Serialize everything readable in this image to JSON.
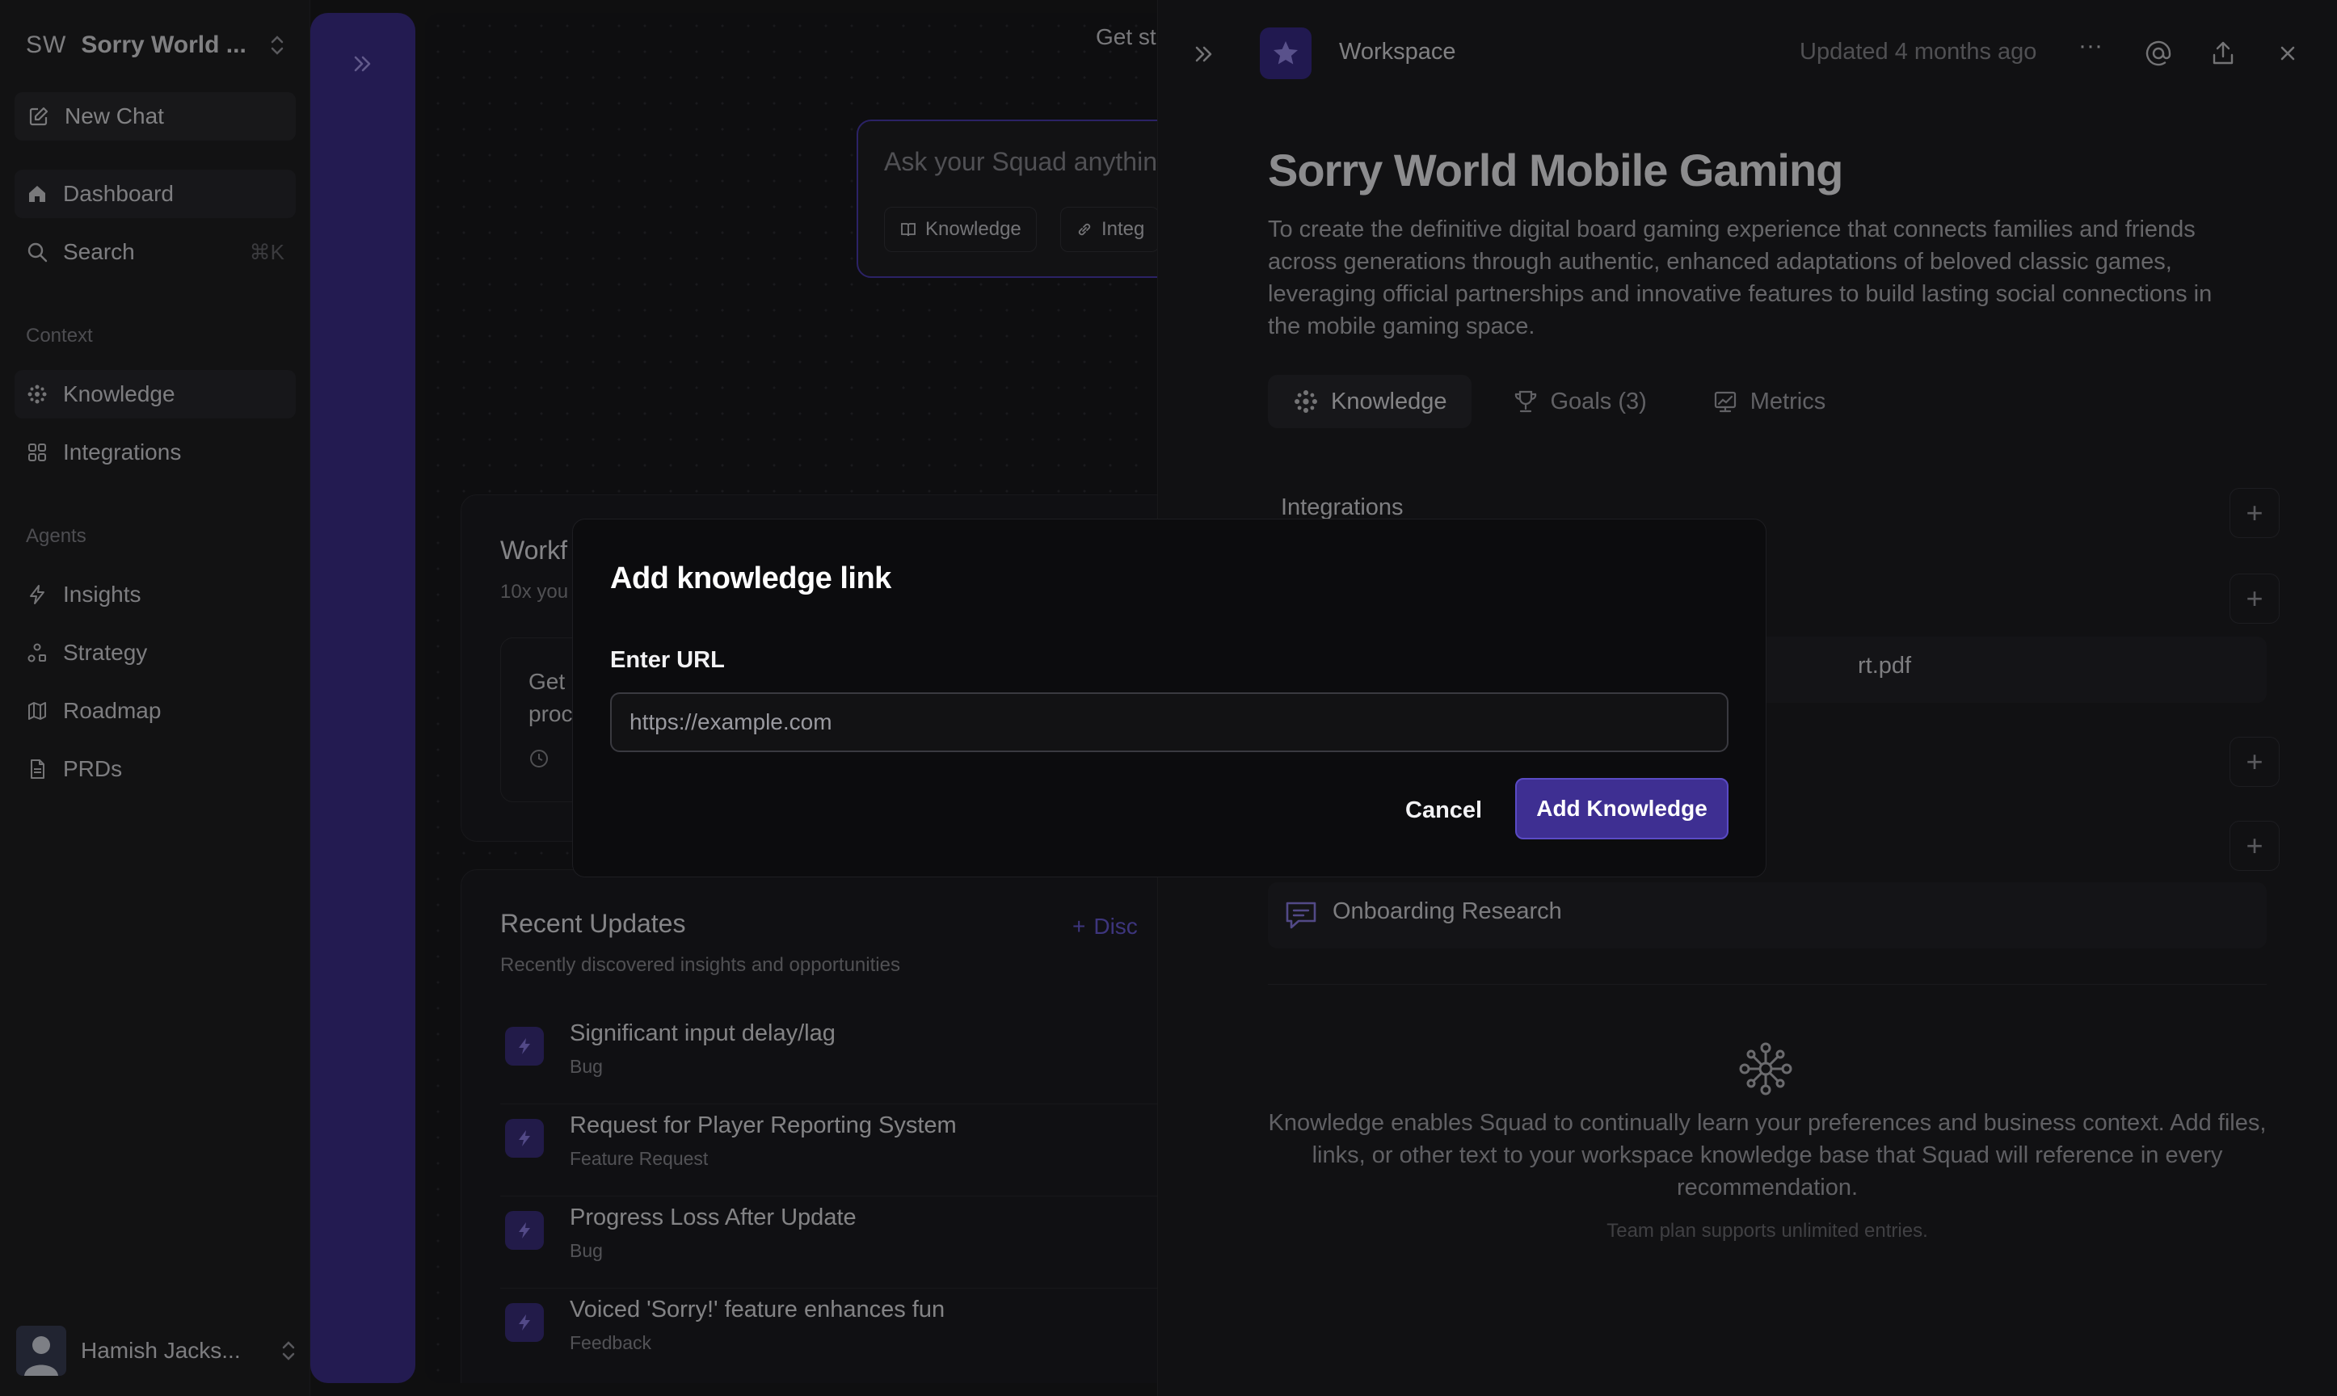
{
  "sidebar": {
    "workspace_abbr": "SW",
    "workspace_name": "Sorry World ...",
    "new_chat": "New Chat",
    "dashboard": "Dashboard",
    "search": "Search",
    "search_shortcut": "⌘K",
    "context_label": "Context",
    "knowledge": "Knowledge",
    "integrations": "Integrations",
    "agents_label": "Agents",
    "insights": "Insights",
    "strategy": "Strategy",
    "roadmap": "Roadmap",
    "prds": "PRDs",
    "user_name": "Hamish Jacks..."
  },
  "middle": {
    "get_started": "Get st",
    "ask_placeholder": "Ask your Squad anythin",
    "chip_knowledge": "Knowledge",
    "chip_integrations": "Integ",
    "workflows_title": "Workf",
    "workflows_sub": "10x you",
    "workflow_card_line1": "Get",
    "workflow_card_line2": "proc",
    "recent_title": "Recent Updates",
    "recent_sub": "Recently discovered insights and opportunities",
    "discover": "Disc",
    "updates": [
      {
        "title": "Significant input delay/lag",
        "kind": "Bug"
      },
      {
        "title": "Request for Player Reporting System",
        "kind": "Feature Request"
      },
      {
        "title": "Progress Loss After Update",
        "kind": "Bug"
      },
      {
        "title": "Voiced 'Sorry!' feature enhances fun",
        "kind": "Feedback"
      }
    ]
  },
  "panel": {
    "workspace_label": "Workspace",
    "updated": "Updated 4 months ago",
    "title": "Sorry World Mobile Gaming",
    "description": "To create the definitive digital board gaming experience that connects families and friends across generations through authentic, enhanced adaptations of beloved classic games, leveraging official partnerships and innovative features to build lasting social connections in the mobile gaming space.",
    "tabs": {
      "knowledge": "Knowledge",
      "goals": "Goals (3)",
      "metrics": "Metrics"
    },
    "integrations_label": "Integrations",
    "file_partial": "rt.pdf",
    "onboarding": "Onboarding Research",
    "empty_text": "Knowledge enables Squad to continually learn your preferences and business context. Add files, links, or other text to your workspace knowledge base that Squad will reference in every recommendation.",
    "team_plan": "Team plan supports unlimited entries."
  },
  "modal": {
    "title": "Add knowledge link",
    "label": "Enter URL",
    "placeholder": "https://example.com",
    "value": "",
    "cancel": "Cancel",
    "submit": "Add Knowledge"
  },
  "colors": {
    "accent": "#3e2f92",
    "rail": "#3d2f8c",
    "background": "#1b1b1d"
  }
}
